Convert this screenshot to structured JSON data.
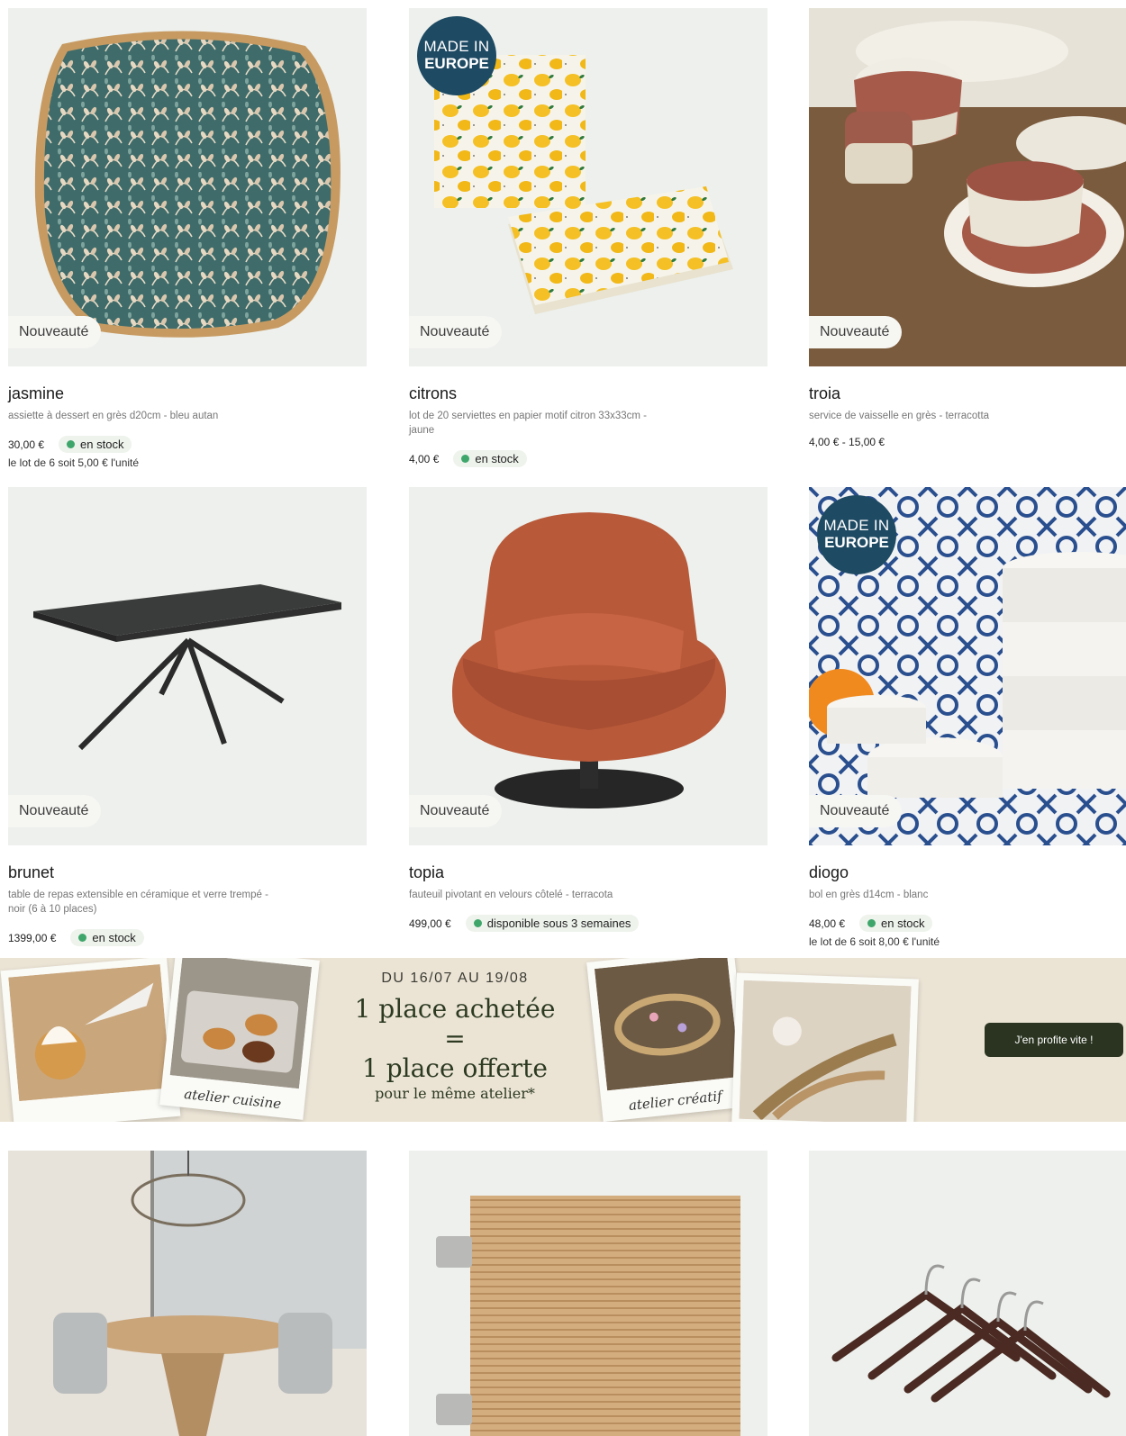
{
  "products": [
    {
      "badge": "Nouveauté",
      "title": "jasmine",
      "desc": "assiette à dessert en grès d20cm - bleu autan",
      "price": "30,00 €",
      "stock": "en stock",
      "lot": "le lot de 6 soit 5,00 € l'unité"
    },
    {
      "badge": "Nouveauté",
      "europe_l1": "MADE IN",
      "europe_l2": "EUROPE",
      "title": "citrons",
      "desc": "lot de 20 serviettes en papier motif citron 33x33cm - jaune",
      "price": "4,00 €",
      "stock": "en stock"
    },
    {
      "badge": "Nouveauté",
      "title": "troia",
      "desc": "service de vaisselle en grès - terracotta",
      "price": "4,00 € - 15,00 €"
    },
    {
      "badge": "Nouveauté",
      "title": "brunet",
      "desc": "table de repas extensible en céramique et verre trempé - noir (6 à 10 places)",
      "price": "1399,00 €",
      "stock": "en stock"
    },
    {
      "badge": "Nouveauté",
      "title": "topia",
      "desc": "fauteuil pivotant en velours côtelé - terracota",
      "price": "499,00 €",
      "stock": "disponible sous 3 semaines"
    },
    {
      "badge": "Nouveauté",
      "europe_l1": "MADE IN",
      "europe_l2": "EUROPE",
      "title": "diogo",
      "desc": "bol en grès d14cm - blanc",
      "price": "48,00 €",
      "stock": "en stock",
      "lot": "le lot de 6 soit 8,00 € l'unité"
    }
  ],
  "banner": {
    "dates": "DU 16/07 AU 19/08",
    "line1": "1 place achetée",
    "line2": "=",
    "line3": "1 place offerte",
    "line4": "pour le même atelier*",
    "caption_left": "atelier cuisine",
    "caption_right": "atelier créatif",
    "cta": "J'en profite vite !"
  },
  "colors": {
    "stock_dot": "#3fa66b",
    "europe_badge": "#1e4a63",
    "cta_bg": "#2a3420",
    "card_bg": "#edf0ec"
  }
}
